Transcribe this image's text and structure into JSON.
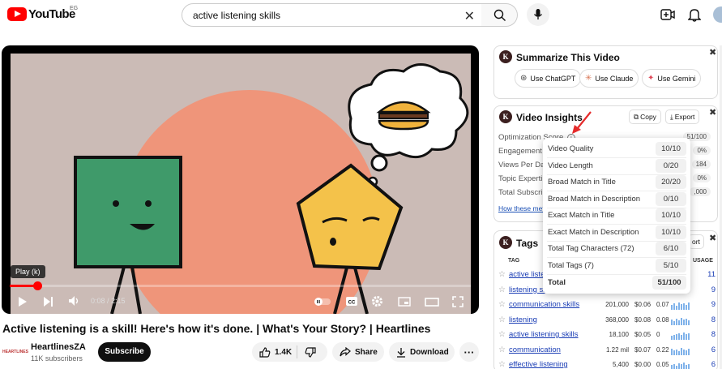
{
  "header": {
    "logo_text": "YouTube",
    "country": "EG",
    "search_value": "active listening skills"
  },
  "player": {
    "tooltip": "Play (k)",
    "time": "0:08 / 2:15",
    "progress": 0.06
  },
  "video": {
    "title": "Active listening is a skill! Here's how it's done. | What's Your Story? | Heartlines",
    "channel_logo": "HEARTLINES",
    "channel": "HeartlinesZA",
    "subscribers": "11K subscribers",
    "subscribe_label": "Subscribe",
    "likes": "1.4K",
    "share_label": "Share",
    "download_label": "Download"
  },
  "summarize": {
    "logo": "K",
    "title": "Summarize This Video",
    "buttons": [
      "Use ChatGPT",
      "Use Claude",
      "Use Gemini"
    ]
  },
  "insights": {
    "logo": "K",
    "title": "Video Insights",
    "copy_label": "Copy",
    "export_label": "Export",
    "rows": [
      {
        "label": "Optimization Score",
        "value": "51/100"
      },
      {
        "label": "Engagement",
        "value": "0%"
      },
      {
        "label": "Views Per Da",
        "value": "184"
      },
      {
        "label": "Topic Experti",
        "value": "0%"
      },
      {
        "label": "Total Subscri",
        "value": ",000"
      }
    ],
    "link": "How these metr"
  },
  "tags": {
    "logo": "K",
    "title": "Tags",
    "export_partial": "ort",
    "col_tag": "TAG",
    "col_usage": "USAGE",
    "rows": [
      {
        "name": "active liste",
        "volume": "",
        "cpc": "",
        "comp": "",
        "usage": "11"
      },
      {
        "name": "listening sl",
        "volume": "",
        "cpc": "",
        "comp": "",
        "usage": "9"
      },
      {
        "name": "communication skills",
        "volume": "201,000",
        "cpc": "$0.06",
        "comp": "0.07",
        "usage": "9"
      },
      {
        "name": "listening",
        "volume": "368,000",
        "cpc": "$0.08",
        "comp": "0.08",
        "usage": "8"
      },
      {
        "name": "active listening skills",
        "volume": "18,100",
        "cpc": "$0.05",
        "comp": "0",
        "usage": "8"
      },
      {
        "name": "communication",
        "volume": "1.22 mil",
        "cpc": "$0.07",
        "comp": "0.22",
        "usage": "6"
      },
      {
        "name": "effective listening",
        "volume": "5,400",
        "cpc": "$0.00",
        "comp": "0.05",
        "usage": "6"
      }
    ]
  },
  "score_popup": {
    "rows": [
      {
        "label": "Video Quality",
        "value": "10/10"
      },
      {
        "label": "Video Length",
        "value": "0/20"
      },
      {
        "label": "Broad Match in Title",
        "value": "20/20"
      },
      {
        "label": "Broad Match in Description",
        "value": "0/10"
      },
      {
        "label": "Exact Match in Title",
        "value": "10/10"
      },
      {
        "label": "Exact Match in Description",
        "value": "10/10"
      },
      {
        "label": "Total Tag Characters (72)",
        "value": "6/10"
      },
      {
        "label": "Total Tags (7)",
        "value": "5/10"
      }
    ],
    "total_label": "Total",
    "total_value": "51/100"
  },
  "colors": {
    "brand_red": "#ff0000",
    "link_blue": "#1a3db5",
    "circle_orange": "#ef957a",
    "square_green": "#3f9a6a",
    "pentagon_yellow": "#f4c24a"
  }
}
